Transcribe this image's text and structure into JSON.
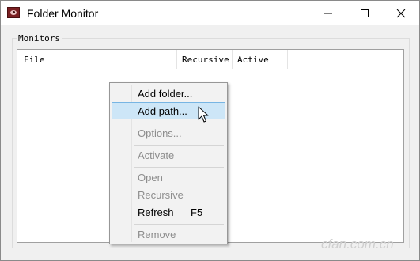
{
  "window": {
    "title": "Folder Monitor",
    "icons": {
      "app": "folder-monitor-eye-icon",
      "minimize": "minimize-icon",
      "maximize": "maximize-icon",
      "close": "close-icon"
    }
  },
  "monitors": {
    "group_label": "Monitors",
    "columns": [
      "File",
      "Recursive",
      "Active"
    ],
    "rows": []
  },
  "context_menu": {
    "items": [
      {
        "label": "Add folder...",
        "enabled": true
      },
      {
        "label": "Add path...",
        "enabled": true,
        "highlighted": true
      },
      {
        "label": "Options...",
        "enabled": false
      },
      {
        "label": "Activate",
        "enabled": false
      },
      {
        "label": "Open",
        "enabled": false
      },
      {
        "label": "Recursive",
        "enabled": false
      },
      {
        "label": "Refresh",
        "shortcut": "F5",
        "enabled": true
      },
      {
        "label": "Remove",
        "enabled": false
      }
    ]
  },
  "cursor": "arrow-pointer-icon",
  "watermark": "cfan.com.cn",
  "colors": {
    "highlight_bg": "#cde6f7",
    "highlight_border": "#77b5e3",
    "app_icon": "#7a1f22",
    "disabled_text": "#8d8d8d"
  }
}
